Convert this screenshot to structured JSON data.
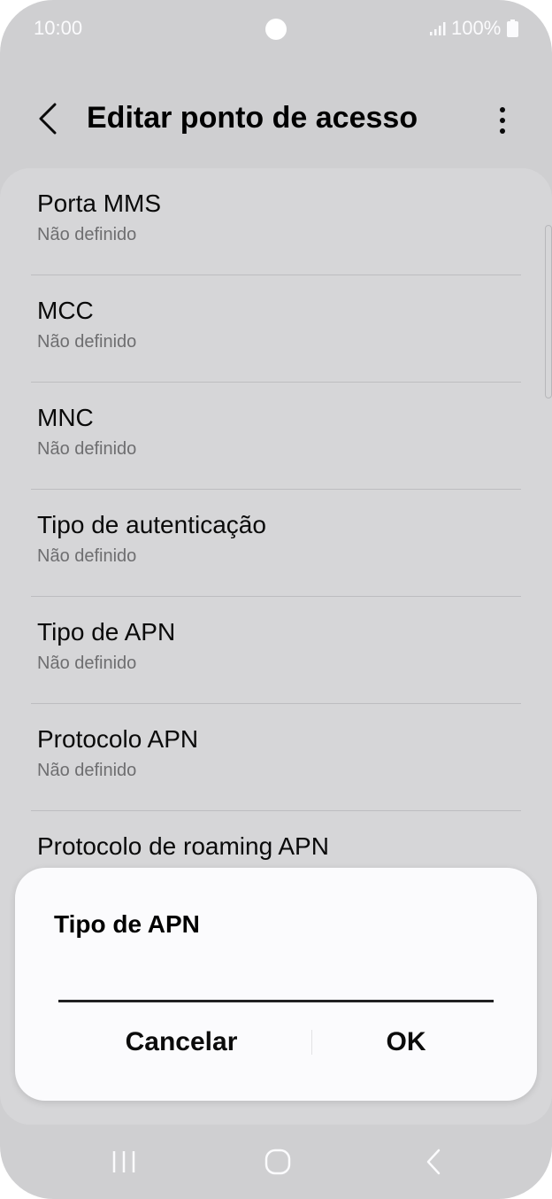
{
  "status_bar": {
    "time": "10:00",
    "battery": "100%",
    "icons": [
      "camera-dot",
      "signal-icon",
      "battery-icon"
    ]
  },
  "header": {
    "title": "Editar ponto de acesso",
    "back_icon": "chevron-left-icon",
    "more_icon": "more-vertical-icon"
  },
  "settings": [
    {
      "title": "Porta MMS",
      "value": "Não definido"
    },
    {
      "title": "MCC",
      "value": "Não definido"
    },
    {
      "title": "MNC",
      "value": "Não definido"
    },
    {
      "title": "Tipo de autenticação",
      "value": "Não definido"
    },
    {
      "title": "Tipo de APN",
      "value": "Não definido"
    },
    {
      "title": "Protocolo APN",
      "value": "Não definido"
    },
    {
      "title": "Protocolo de roaming APN",
      "value": ""
    }
  ],
  "dialog": {
    "title": "Tipo de APN",
    "input_value": "",
    "cancel_label": "Cancelar",
    "ok_label": "OK"
  },
  "nav_bar": {
    "icons": [
      "recents-icon",
      "home-icon",
      "back-icon"
    ]
  },
  "colors": {
    "background": "#cfcfd1",
    "card": "#d6d6d8",
    "dialog": "#fbfbfd",
    "text_primary": "#0a0a0a",
    "text_secondary": "#6e6e70"
  }
}
